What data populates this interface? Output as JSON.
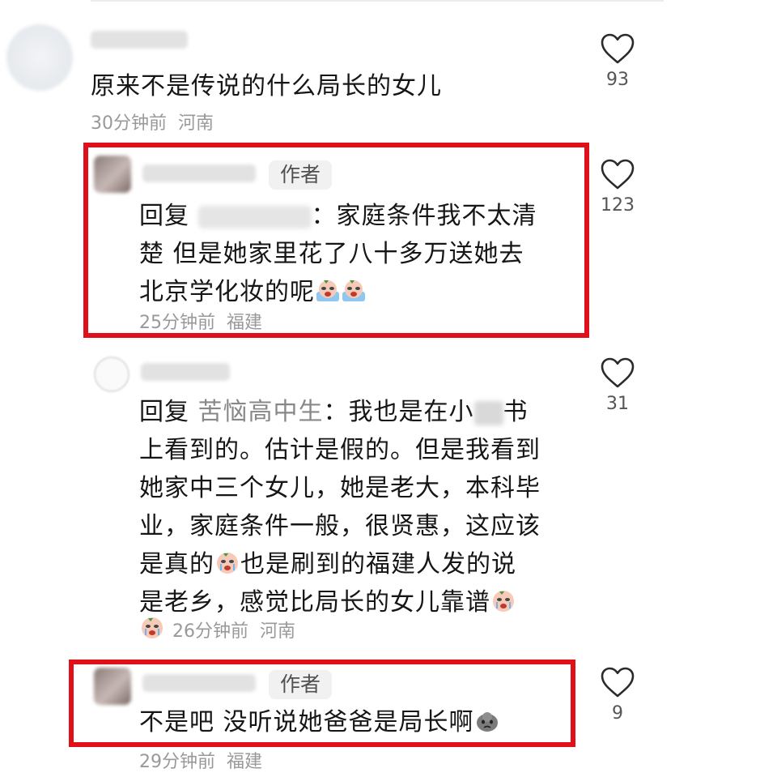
{
  "comments": [
    {
      "text": "原来不是传说的什么局长的女儿",
      "time": "30分钟前",
      "location": "河南",
      "likes": "93"
    },
    {
      "tag": "作者",
      "reply_label": "回复",
      "lines": [
        "：家庭条件我不太清",
        "楚 但是她家里花了八十多万送她去",
        "北京学化妆的呢"
      ],
      "time": "25分钟前",
      "location": "福建",
      "likes": "123"
    },
    {
      "reply_label": "回复",
      "reply_to": "苦恼高中生",
      "lines": [
        "：我也是在小",
        "书",
        "上看到的。估计是假的。但是我看到",
        "她家中三个女儿，她是老大，本科毕",
        "业，家庭条件一般，很贤惠，这应该",
        "是真的",
        "也是刷到的福建人发的说",
        "是老乡，感觉比局长的女儿靠谱"
      ],
      "time": "26分钟前",
      "location": "河南",
      "likes": "31"
    },
    {
      "tag": "作者",
      "text": "不是吧 没听说她爸爸是局长啊",
      "time": "29分钟前",
      "location": "福建",
      "likes": "9"
    }
  ],
  "icons": {
    "like": "heart-outline-icon",
    "emoji_cry": "crying-face-emoji",
    "emoji_sweat": "sweat-face-emoji"
  },
  "colors": {
    "highlight_border": "#e0101a",
    "secondary_text": "#999999",
    "reply_name": "#888888"
  }
}
